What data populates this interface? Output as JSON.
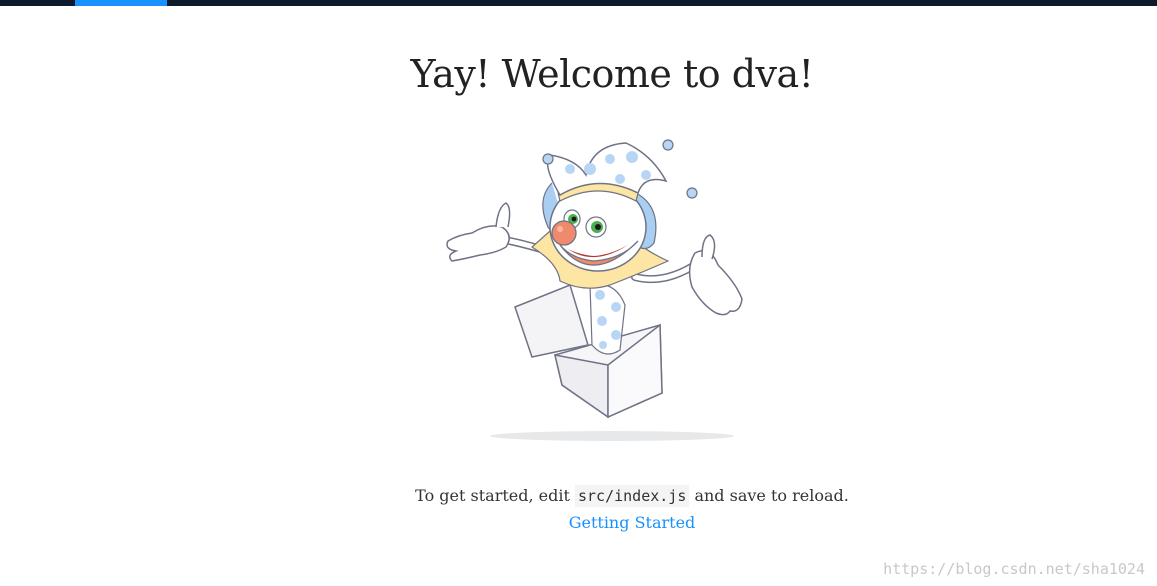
{
  "page": {
    "title": "Yay! Welcome to dva!"
  },
  "mascot": {
    "icon": "jack-in-the-box-clown-icon"
  },
  "intro": {
    "before": "To get started, edit ",
    "code": "src/index.js",
    "after": " and save to reload."
  },
  "links": {
    "getting_started": "Getting Started"
  },
  "watermark": {
    "text": "https://blog.csdn.net/sha1024"
  },
  "colors": {
    "topbar": "#0c1a2b",
    "accent": "#1890ff",
    "dots": "#b7d6f5"
  }
}
